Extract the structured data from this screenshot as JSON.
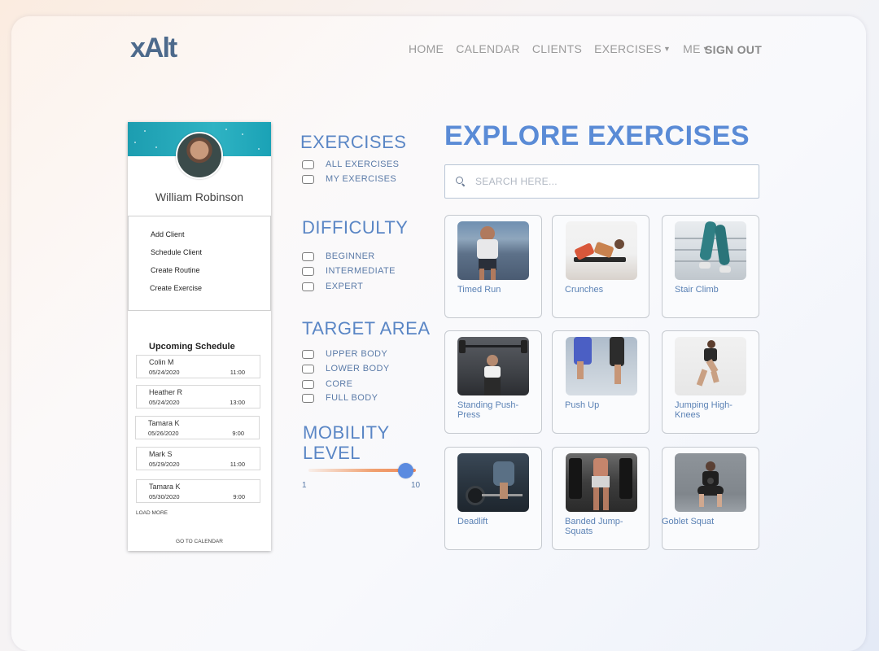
{
  "brand": {
    "logo": "xAlt"
  },
  "nav": {
    "items": [
      "HOME",
      "CALENDAR",
      "CLIENTS",
      "EXERCISES",
      "ME"
    ],
    "signout": "SIGN OUT"
  },
  "profile": {
    "name": "William Robinson",
    "actions": [
      "Add Client",
      "Schedule Client",
      "Create Routine",
      "Create Exercise"
    ],
    "schedule_title": "Upcoming Schedule",
    "schedule": [
      {
        "name": "Colin M",
        "date": "05/24/2020",
        "time": "11:00"
      },
      {
        "name": "Heather R",
        "date": "05/24/2020",
        "time": "13:00"
      },
      {
        "name": "Tamara K",
        "date": "05/26/2020",
        "time": "9:00"
      },
      {
        "name": "Mark S",
        "date": "05/29/2020",
        "time": "11:00"
      },
      {
        "name": "Tamara K",
        "date": "05/30/2020",
        "time": "9:00"
      }
    ],
    "load_more": "LOAD MORE",
    "go_calendar": "GO TO CALENDAR"
  },
  "filters": {
    "exercises": {
      "title": "EXERCISES",
      "options": [
        "ALL EXERCISES",
        "MY EXERCISES"
      ]
    },
    "difficulty": {
      "title": "DIFFICULTY",
      "options": [
        "BEGINNER",
        "INTERMEDIATE",
        "EXPERT"
      ]
    },
    "target": {
      "title": "TARGET AREA",
      "options": [
        "UPPER BODY",
        "LOWER BODY",
        "CORE",
        "FULL BODY"
      ]
    },
    "mobility": {
      "title_line1": "MOBILITY",
      "title_line2": "LEVEL",
      "min": "1",
      "max": "10",
      "value": 10
    }
  },
  "main": {
    "title": "EXPLORE EXERCISES",
    "search_placeholder": "SEARCH HERE...",
    "exercises": [
      {
        "label": "Timed Run"
      },
      {
        "label": "Crunches"
      },
      {
        "label": "Stair Climb"
      },
      {
        "label": "Standing Push-Press"
      },
      {
        "label": "Push Up"
      },
      {
        "label": "Jumping High-Knees"
      },
      {
        "label": "Deadlift"
      },
      {
        "label": "Banded Jump-Squats"
      },
      {
        "label": "Goblet Squat"
      }
    ]
  },
  "colors": {
    "accent": "#5a8bd6",
    "banner": "#1fa3b6",
    "slider": "#f0a070",
    "thumb": "#5b8be0"
  }
}
